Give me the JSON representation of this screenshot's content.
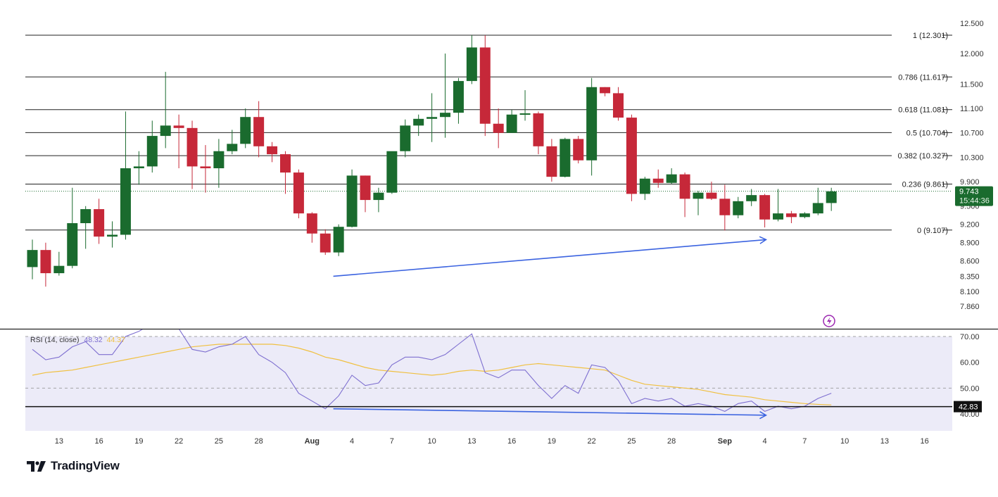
{
  "brand": {
    "name": "TradingView",
    "icon": "tradingview-logo-icon"
  },
  "colors": {
    "up": "#1a6b2e",
    "down": "#c62839",
    "rsi": "#7e6fd0",
    "rsi_ma": "#f0c040",
    "arrow": "#3b63e0",
    "rsi_band": "#ecebf8",
    "text": "#333333"
  },
  "chart_data": [
    {
      "type": "candlestick",
      "price_axis": {
        "ylim": [
          7.86,
          12.5
        ],
        "ticks": [
          "12.500",
          "12.000",
          "11.500",
          "11.100",
          "10.700",
          "10.300",
          "9.900",
          "9.500",
          "9.200",
          "8.900",
          "8.600",
          "8.350",
          "8.100",
          "7.860"
        ]
      },
      "x_axis": {
        "ticks": [
          {
            "label": "13",
            "x": 2
          },
          {
            "label": "16",
            "x": 5
          },
          {
            "label": "19",
            "x": 8
          },
          {
            "label": "22",
            "x": 11
          },
          {
            "label": "25",
            "x": 14
          },
          {
            "label": "28",
            "x": 17
          },
          {
            "label": "Aug",
            "x": 21
          },
          {
            "label": "4",
            "x": 24
          },
          {
            "label": "7",
            "x": 27
          },
          {
            "label": "10",
            "x": 30
          },
          {
            "label": "13",
            "x": 33
          },
          {
            "label": "16",
            "x": 36
          },
          {
            "label": "19",
            "x": 39
          },
          {
            "label": "22",
            "x": 42
          },
          {
            "label": "25",
            "x": 45
          },
          {
            "label": "28",
            "x": 48
          },
          {
            "label": "Sep",
            "x": 52
          },
          {
            "label": "4",
            "x": 55
          },
          {
            "label": "7",
            "x": 58
          },
          {
            "label": "10",
            "x": 61
          },
          {
            "label": "13",
            "x": 64
          },
          {
            "label": "16",
            "x": 67
          }
        ]
      },
      "candles": [
        {
          "x": 0,
          "o": 8.5,
          "h": 8.95,
          "l": 8.3,
          "c": 8.78
        },
        {
          "x": 1,
          "o": 8.78,
          "h": 8.9,
          "l": 8.18,
          "c": 8.4
        },
        {
          "x": 2,
          "o": 8.4,
          "h": 8.75,
          "l": 8.36,
          "c": 8.52
        },
        {
          "x": 3,
          "o": 8.52,
          "h": 9.8,
          "l": 8.48,
          "c": 9.22
        },
        {
          "x": 4,
          "o": 9.22,
          "h": 9.5,
          "l": 8.8,
          "c": 9.45
        },
        {
          "x": 5,
          "o": 9.45,
          "h": 9.62,
          "l": 8.88,
          "c": 9.0
        },
        {
          "x": 6,
          "o": 9.0,
          "h": 9.25,
          "l": 8.82,
          "c": 9.03
        },
        {
          "x": 7,
          "o": 9.03,
          "h": 11.05,
          "l": 8.95,
          "c": 10.12
        },
        {
          "x": 8,
          "o": 10.12,
          "h": 10.4,
          "l": 9.85,
          "c": 10.15
        },
        {
          "x": 9,
          "o": 10.15,
          "h": 10.9,
          "l": 10.05,
          "c": 10.65
        },
        {
          "x": 10,
          "o": 10.65,
          "h": 11.7,
          "l": 10.45,
          "c": 10.82
        },
        {
          "x": 11,
          "o": 10.82,
          "h": 11.0,
          "l": 10.12,
          "c": 10.78
        },
        {
          "x": 12,
          "o": 10.78,
          "h": 10.9,
          "l": 9.78,
          "c": 10.15
        },
        {
          "x": 13,
          "o": 10.15,
          "h": 10.5,
          "l": 9.72,
          "c": 10.12
        },
        {
          "x": 14,
          "o": 10.12,
          "h": 10.6,
          "l": 9.8,
          "c": 10.4
        },
        {
          "x": 15,
          "o": 10.4,
          "h": 10.75,
          "l": 10.35,
          "c": 10.52
        },
        {
          "x": 16,
          "o": 10.52,
          "h": 11.1,
          "l": 10.45,
          "c": 10.96
        },
        {
          "x": 17,
          "o": 10.96,
          "h": 11.22,
          "l": 10.3,
          "c": 10.48
        },
        {
          "x": 18,
          "o": 10.48,
          "h": 10.55,
          "l": 10.22,
          "c": 10.35
        },
        {
          "x": 19,
          "o": 10.35,
          "h": 10.4,
          "l": 9.7,
          "c": 10.05
        },
        {
          "x": 20,
          "o": 10.05,
          "h": 10.1,
          "l": 9.3,
          "c": 9.38
        },
        {
          "x": 21,
          "o": 9.38,
          "h": 9.4,
          "l": 8.9,
          "c": 9.05
        },
        {
          "x": 22,
          "o": 9.05,
          "h": 9.12,
          "l": 8.7,
          "c": 8.74
        },
        {
          "x": 23,
          "o": 8.74,
          "h": 9.2,
          "l": 8.68,
          "c": 9.16
        },
        {
          "x": 24,
          "o": 9.16,
          "h": 10.1,
          "l": 9.15,
          "c": 10.0
        },
        {
          "x": 25,
          "o": 10.0,
          "h": 10.0,
          "l": 9.4,
          "c": 9.6
        },
        {
          "x": 26,
          "o": 9.6,
          "h": 9.8,
          "l": 9.4,
          "c": 9.72
        },
        {
          "x": 27,
          "o": 9.72,
          "h": 10.25,
          "l": 9.7,
          "c": 10.4
        },
        {
          "x": 28,
          "o": 10.4,
          "h": 10.92,
          "l": 10.3,
          "c": 10.82
        },
        {
          "x": 29,
          "o": 10.82,
          "h": 11.0,
          "l": 10.65,
          "c": 10.93
        },
        {
          "x": 30,
          "o": 10.93,
          "h": 11.35,
          "l": 10.55,
          "c": 10.96
        },
        {
          "x": 31,
          "o": 10.96,
          "h": 12.0,
          "l": 10.62,
          "c": 11.03
        },
        {
          "x": 32,
          "o": 11.03,
          "h": 11.6,
          "l": 10.85,
          "c": 11.55
        },
        {
          "x": 33,
          "o": 11.55,
          "h": 12.3,
          "l": 11.5,
          "c": 12.1
        },
        {
          "x": 34,
          "o": 12.1,
          "h": 12.3,
          "l": 10.65,
          "c": 10.85
        },
        {
          "x": 35,
          "o": 10.85,
          "h": 11.1,
          "l": 10.45,
          "c": 10.7
        },
        {
          "x": 36,
          "o": 10.7,
          "h": 11.08,
          "l": 10.7,
          "c": 11.0
        },
        {
          "x": 37,
          "o": 11.0,
          "h": 11.4,
          "l": 10.9,
          "c": 11.02
        },
        {
          "x": 38,
          "o": 11.02,
          "h": 11.05,
          "l": 10.35,
          "c": 10.48
        },
        {
          "x": 39,
          "o": 10.48,
          "h": 10.6,
          "l": 9.9,
          "c": 9.98
        },
        {
          "x": 40,
          "o": 9.98,
          "h": 10.62,
          "l": 9.97,
          "c": 10.6
        },
        {
          "x": 41,
          "o": 10.6,
          "h": 10.65,
          "l": 10.2,
          "c": 10.25
        },
        {
          "x": 42,
          "o": 10.25,
          "h": 11.6,
          "l": 10.0,
          "c": 11.45
        },
        {
          "x": 43,
          "o": 11.45,
          "h": 11.45,
          "l": 11.3,
          "c": 11.35
        },
        {
          "x": 44,
          "o": 11.35,
          "h": 11.45,
          "l": 10.9,
          "c": 10.95
        },
        {
          "x": 45,
          "o": 10.95,
          "h": 11.0,
          "l": 9.58,
          "c": 9.7
        },
        {
          "x": 46,
          "o": 9.7,
          "h": 9.98,
          "l": 9.6,
          "c": 9.95
        },
        {
          "x": 47,
          "o": 9.95,
          "h": 10.1,
          "l": 9.8,
          "c": 9.88
        },
        {
          "x": 48,
          "o": 9.88,
          "h": 10.12,
          "l": 9.86,
          "c": 10.02
        },
        {
          "x": 49,
          "o": 10.02,
          "h": 10.05,
          "l": 9.32,
          "c": 9.62
        },
        {
          "x": 50,
          "o": 9.62,
          "h": 9.75,
          "l": 9.35,
          "c": 9.72
        },
        {
          "x": 51,
          "o": 9.72,
          "h": 9.9,
          "l": 9.6,
          "c": 9.62
        },
        {
          "x": 52,
          "o": 9.62,
          "h": 9.85,
          "l": 9.1,
          "c": 9.35
        },
        {
          "x": 53,
          "o": 9.35,
          "h": 9.65,
          "l": 9.3,
          "c": 9.58
        },
        {
          "x": 54,
          "o": 9.58,
          "h": 9.78,
          "l": 9.5,
          "c": 9.68
        },
        {
          "x": 55,
          "o": 9.68,
          "h": 9.7,
          "l": 9.15,
          "c": 9.28
        },
        {
          "x": 56,
          "o": 9.28,
          "h": 9.78,
          "l": 9.25,
          "c": 9.38
        },
        {
          "x": 57,
          "o": 9.38,
          "h": 9.42,
          "l": 9.22,
          "c": 9.32
        },
        {
          "x": 58,
          "o": 9.32,
          "h": 9.4,
          "l": 9.3,
          "c": 9.38
        },
        {
          "x": 59,
          "o": 9.38,
          "h": 9.8,
          "l": 9.35,
          "c": 9.55
        },
        {
          "x": 60,
          "o": 9.55,
          "h": 9.8,
          "l": 9.42,
          "c": 9.74
        }
      ],
      "fib_levels": [
        {
          "label": "1 (12.301)",
          "value": 12.301
        },
        {
          "label": "0.786 (11.617)",
          "value": 11.617
        },
        {
          "label": "0.618 (11.081)",
          "value": 11.081
        },
        {
          "label": "0.5 (10.704)",
          "value": 10.704
        },
        {
          "label": "0.382 (10.327)",
          "value": 10.327
        },
        {
          "label": "0.236 (9.861)",
          "value": 9.861
        },
        {
          "label": "0 (9.107)",
          "value": 9.107
        }
      ],
      "last_price": {
        "value": 9.743,
        "label": "9.743",
        "countdown": "15:44:36"
      },
      "trend_arrow": {
        "x1": 22.6,
        "y1": 8.35,
        "x2": 55.1,
        "y2": 8.95
      }
    },
    {
      "type": "line",
      "title": "RSI (14, close)",
      "values_label": [
        "48.32",
        "44.37"
      ],
      "ylim": [
        36,
        72
      ],
      "ticks": [
        "70.00",
        "60.00",
        "50.00",
        "40.00"
      ],
      "level_label": "42.83",
      "series": [
        {
          "name": "RSI",
          "values": [
            65,
            61,
            62,
            66,
            68,
            63,
            63,
            70,
            72,
            75,
            76,
            73,
            65,
            64,
            66,
            67,
            70,
            63,
            60,
            56,
            48,
            45,
            42,
            47,
            55,
            51,
            52,
            59,
            62,
            62,
            61,
            63,
            67,
            71,
            56,
            54,
            57,
            57,
            51,
            46,
            51,
            48,
            59,
            58,
            53,
            44,
            46,
            45,
            46,
            43,
            44,
            43,
            41,
            44,
            45,
            41,
            43,
            42,
            43,
            46,
            48
          ]
        },
        {
          "name": "RSI MA",
          "values": [
            55,
            56,
            56.5,
            57,
            58,
            59,
            60,
            61,
            62,
            63,
            64,
            65,
            66,
            66.5,
            67,
            67,
            67,
            67,
            67,
            66.5,
            65.5,
            64,
            62,
            61,
            59.5,
            58,
            57,
            56.5,
            56,
            55.5,
            55,
            55.5,
            56.5,
            57,
            56.5,
            57,
            58,
            59,
            59.5,
            59,
            58.5,
            58,
            57.5,
            57,
            55,
            53,
            51.5,
            51,
            50.5,
            50,
            49.5,
            48.5,
            47.5,
            47,
            46.5,
            45.5,
            45,
            44.5,
            44,
            43.7,
            43.5
          ]
        }
      ],
      "div_arrow": {
        "x1": 22.6,
        "y1": 42.0,
        "x2": 55.1,
        "y2": 39.5
      }
    }
  ]
}
